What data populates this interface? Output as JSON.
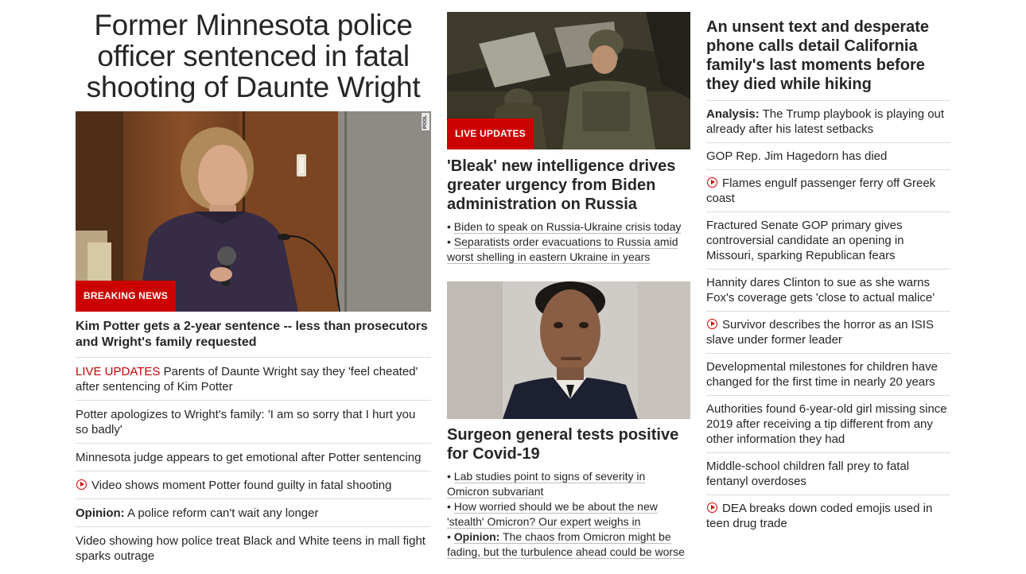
{
  "lead": {
    "headline": "Former Minnesota police officer sentenced in fatal shooting of Daunte Wright",
    "badge": "BREAKING NEWS",
    "pool_label": "POOL",
    "caption": "Kim Potter gets a 2-year sentence -- less than prosecutors and Wright's family requested",
    "items": [
      {
        "prefix": "LIVE UPDATES",
        "text": "Parents of Daunte Wright say they 'feel cheated' after sentencing of Kim Potter"
      },
      {
        "text": "Potter apologizes to Wright's family: 'I am so sorry that I hurt you so badly'"
      },
      {
        "text": "Minnesota judge appears to get emotional after Potter sentencing"
      },
      {
        "video": true,
        "text": "Video shows moment Potter found guilty in fatal shooting"
      },
      {
        "label": "Opinion:",
        "text": "A police reform can't wait any longer"
      },
      {
        "text": "Video showing how police treat Black and White teens in mall fight sparks outrage"
      }
    ]
  },
  "russia": {
    "badge": "LIVE UPDATES",
    "headline": "'Bleak' new intelligence drives greater urgency from Biden administration on Russia",
    "bullets": [
      {
        "text": "Biden to speak on Russia-Ukraine crisis today"
      },
      {
        "text": "Separatists order evacuations to Russia amid worst shelling in eastern Ukraine in years"
      }
    ]
  },
  "covid": {
    "headline": "Surgeon general tests positive for Covid-19",
    "bullets": [
      {
        "text": "Lab studies point to signs of severity in Omicron subvariant"
      },
      {
        "text": "How worried should we be about the new 'stealth' Omicron? Our expert weighs in"
      },
      {
        "label": "Opinion:",
        "text": "The chaos from Omicron might be fading, but the turbulence ahead could be worse"
      }
    ]
  },
  "side": {
    "headline": "An unsent text and desperate phone calls detail California family's last moments before they died while hiking",
    "items": [
      {
        "label": "Analysis:",
        "text": "The Trump playbook is playing out already after his latest setbacks"
      },
      {
        "text": "GOP Rep. Jim Hagedorn has died"
      },
      {
        "video": true,
        "text": "Flames engulf passenger ferry off Greek coast"
      },
      {
        "text": "Fractured Senate GOP primary gives controversial candidate an opening in Missouri, sparking Republican fears"
      },
      {
        "text": "Hannity dares Clinton to sue as she warns Fox's coverage gets 'close to actual malice'"
      },
      {
        "video": true,
        "text": "Survivor describes the horror as an ISIS slave under former leader"
      },
      {
        "text": "Developmental milestones for children have changed for the first time in nearly 20 years"
      },
      {
        "text": "Authorities found 6-year-old girl missing since 2019 after receiving a tip different from any other information they had"
      },
      {
        "text": "Middle-school children fall prey to fatal fentanyl overdoses"
      },
      {
        "video": true,
        "text": "DEA breaks down coded emojis used in teen drug trade"
      }
    ]
  },
  "colors": {
    "accent": "#cc0000",
    "text": "#262626",
    "divider": "#dcdcdc"
  },
  "icons": {
    "video": "play-circle-icon"
  }
}
